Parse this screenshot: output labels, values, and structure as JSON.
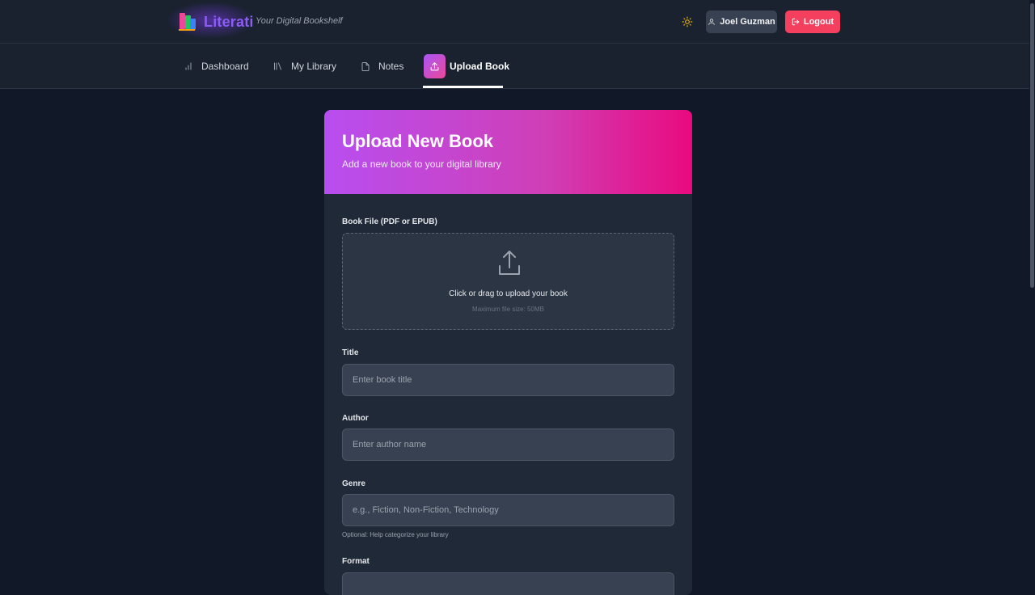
{
  "app": {
    "name": "Literati",
    "tagline": "Your Digital Bookshelf"
  },
  "header": {
    "user_name": "Joel Guzman",
    "logout_label": "Logout"
  },
  "nav": {
    "items": [
      {
        "label": "Dashboard",
        "icon": "bar-chart-icon"
      },
      {
        "label": "My Library",
        "icon": "library-icon"
      },
      {
        "label": "Notes",
        "icon": "document-icon"
      },
      {
        "label": "Upload Book",
        "icon": "upload-icon",
        "active": true
      }
    ]
  },
  "card": {
    "title": "Upload New Book",
    "subtitle": "Add a new book to your digital library"
  },
  "form": {
    "file_label": "Book File (PDF or EPUB)",
    "dropzone_text": "Click or drag to upload your book",
    "dropzone_hint": "Maximum file size: 50MB",
    "title_label": "Title",
    "title_placeholder": "Enter book title",
    "title_value": "",
    "author_label": "Author",
    "author_placeholder": "Enter author name",
    "author_value": "",
    "genre_label": "Genre",
    "genre_placeholder": "e.g., Fiction, Non-Fiction, Technology",
    "genre_value": "",
    "genre_help": "Optional: Help categorize your library",
    "format_label": "Format"
  },
  "colors": {
    "accent_purple": "#a855f7",
    "accent_pink": "#ec4899",
    "logout_red": "#f43f5e",
    "background": "#111827",
    "surface": "#1f2937"
  }
}
